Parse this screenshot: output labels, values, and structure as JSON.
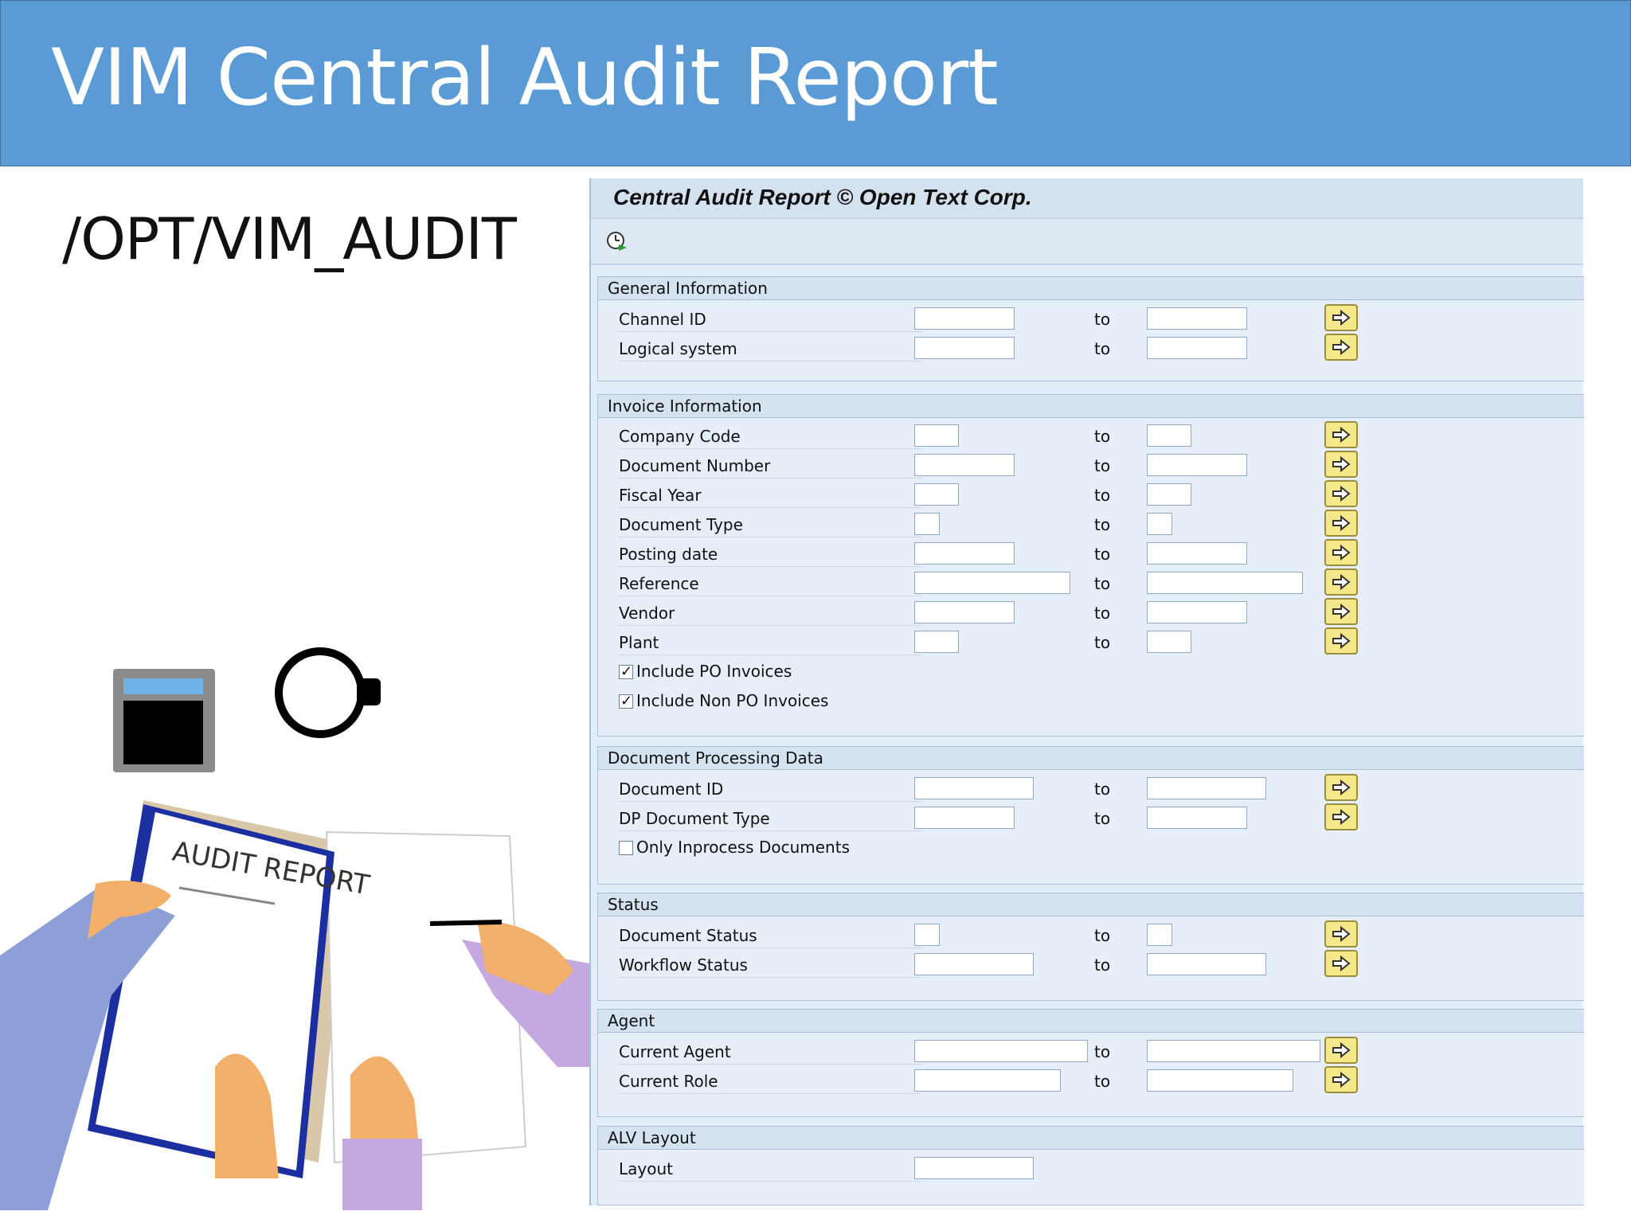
{
  "slide": {
    "title": "VIM Central Audit Report",
    "transaction_code": "/OPT/VIM_AUDIT"
  },
  "illustration": {
    "clipboard_text": "AUDIT REPORT"
  },
  "sap": {
    "title": "Central Audit Report © Open Text Corp.",
    "toolbar": {
      "execute_icon": "execute-clock-icon"
    },
    "to_label": "to",
    "sections": {
      "general": {
        "title": "General Information",
        "fields": [
          "Channel ID",
          "Logical system"
        ]
      },
      "invoice": {
        "title": "Invoice Information",
        "fields": [
          "Company Code",
          "Document Number",
          "Fiscal Year",
          "Document Type",
          "Posting date",
          "Reference",
          "Vendor",
          "Plant"
        ],
        "checkboxes": [
          {
            "label": "Include PO Invoices",
            "checked": true
          },
          {
            "label": "Include Non PO Invoices",
            "checked": true
          }
        ]
      },
      "docproc": {
        "title": "Document Processing Data",
        "fields": [
          "Document ID",
          "DP Document Type"
        ],
        "checkboxes": [
          {
            "label": "Only Inprocess Documents",
            "checked": false
          }
        ]
      },
      "status": {
        "title": "Status",
        "fields": [
          "Document Status",
          "Workflow Status"
        ]
      },
      "agent": {
        "title": "Agent",
        "fields": [
          "Current Agent",
          "Current Role"
        ]
      },
      "alv": {
        "title": "ALV Layout",
        "fields": [
          "Layout"
        ]
      }
    }
  }
}
